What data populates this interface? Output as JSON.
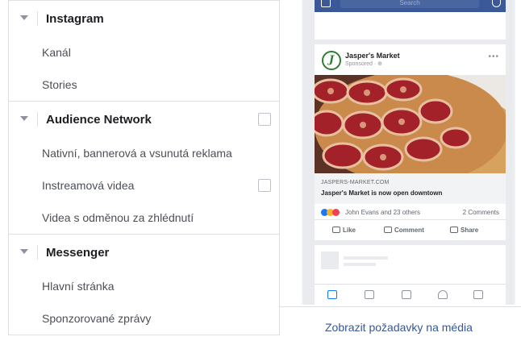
{
  "placements": {
    "sections": [
      {
        "title": "Instagram",
        "has_checkbox": false,
        "items": [
          {
            "label": "Kanál",
            "has_checkbox": false
          },
          {
            "label": "Stories",
            "has_checkbox": false
          }
        ]
      },
      {
        "title": "Audience Network",
        "has_checkbox": true,
        "items": [
          {
            "label": "Nativní, bannerová a vsunutá reklama",
            "has_checkbox": false
          },
          {
            "label": "Instreamová videa",
            "has_checkbox": true
          },
          {
            "label": "Videa s odměnou za zhlédnutí",
            "has_checkbox": false
          }
        ]
      },
      {
        "title": "Messenger",
        "has_checkbox": false,
        "items": [
          {
            "label": "Hlavní stránka",
            "has_checkbox": false
          },
          {
            "label": "Sponzorované zprávy",
            "has_checkbox": false
          }
        ]
      }
    ]
  },
  "preview": {
    "search_placeholder": "Search",
    "page_name": "Jasper's Market",
    "avatar_letter": "J",
    "sponsored": "Sponsored · ⊕",
    "link_url": "JASPERS-MARKET.COM",
    "link_title": "Jasper's Market is now open downtown",
    "reaction_names": "John Evans and 23 others",
    "comments": "2 Comments",
    "actions": [
      "Like",
      "Comment",
      "Share"
    ]
  },
  "footer": {
    "media_requirements_link": "Zobrazit požadavky na média"
  },
  "colors": {
    "facebook_blue": "#3b5998",
    "link_blue": "#365899",
    "border": "#dddfe2"
  }
}
